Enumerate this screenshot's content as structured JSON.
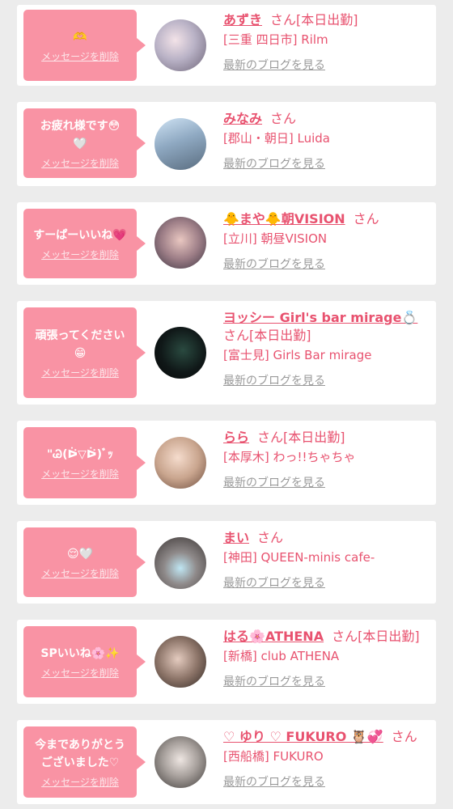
{
  "delete_label": "メッセージを削除",
  "blog_label": "最新のブログを見る",
  "san_label": "さん",
  "items": [
    {
      "message": "🫶",
      "name": "あずき",
      "status": "[本日出勤]",
      "shop": "[三重 四日市] Rilm"
    },
    {
      "message": "お疲れ様です😳\n🤍",
      "name": "みなみ",
      "status": "",
      "shop": "[郡山・朝日] Luida"
    },
    {
      "message": "すーぱーいいね💗",
      "name": "🐥まや🐥朝VISION",
      "status": "",
      "shop": "[立川] 朝昼VISION"
    },
    {
      "message": "頑張ってください\n😁",
      "name": "ヨッシー Girl's bar mirage💍",
      "status": "[本日出勤]",
      "shop": "[富士見] Girls Bar mirage"
    },
    {
      "message": "\"Ꮚ(ᐖ▽ᐖ)ﾞｯ",
      "name": "らら",
      "status": "[本日出勤]",
      "shop": "[本厚木] わっ!!ちゃちゃ"
    },
    {
      "message": "😌🤍",
      "name": "まい",
      "status": "",
      "shop": "[神田] QUEEN-minis cafe-"
    },
    {
      "message": "SPいいね🌸✨",
      "name": "はる🌸ATHENA",
      "status": "[本日出勤]",
      "shop": "[新橋] club ATHENA"
    },
    {
      "message": "今までありがとう\nございました♡",
      "name": "♡ ゆり ♡ FUKURO 🦉💞",
      "status": "",
      "shop": "[西船橋] FUKURO"
    }
  ]
}
